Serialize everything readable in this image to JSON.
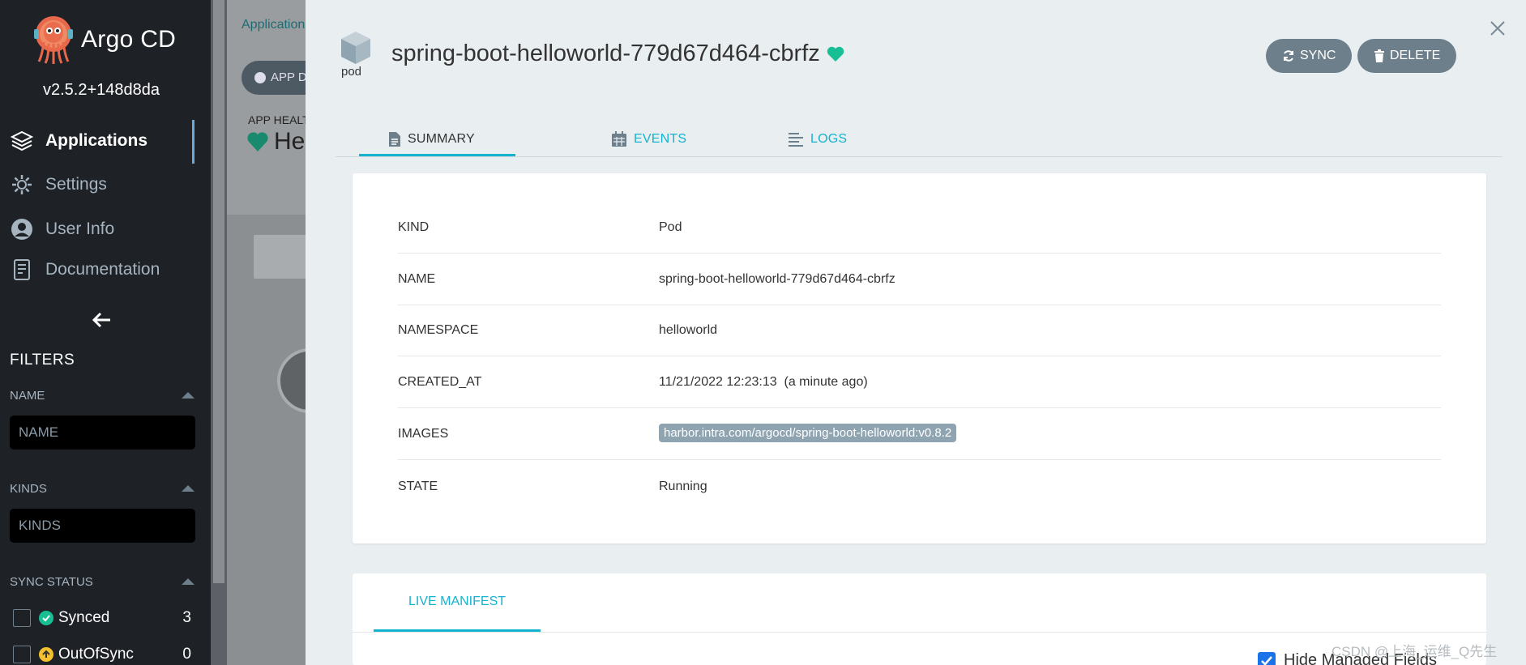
{
  "sidebar": {
    "brand": "Argo CD",
    "version": "v2.5.2+148d8da",
    "nav": [
      {
        "label": "Applications",
        "icon": "layers-icon",
        "active": true
      },
      {
        "label": "Settings",
        "icon": "gear-icon"
      },
      {
        "label": "User Info",
        "icon": "user-icon"
      },
      {
        "label": "Documentation",
        "icon": "book-icon"
      }
    ],
    "filters_title": "FILTERS",
    "name_label": "NAME",
    "name_placeholder": "NAME",
    "kinds_label": "KINDS",
    "kinds_placeholder": "KINDS",
    "sync_status_label": "SYNC STATUS",
    "sync_status": [
      {
        "label": "Synced",
        "count": "3",
        "color": "#18be94"
      },
      {
        "label": "OutOfSync",
        "count": "0",
        "color": "#f4c030"
      }
    ]
  },
  "background": {
    "breadcrumb": "Applications",
    "app_details_button": "APP DETAILS",
    "app_health_label": "APP HEALTH",
    "app_health_value": "Healthy"
  },
  "panel": {
    "kind_icon_label": "pod",
    "title": "spring-boot-helloworld-779d67d464-cbrfz",
    "sync_button": "SYNC",
    "delete_button": "DELETE",
    "tabs": [
      {
        "label": "SUMMARY",
        "icon": "document-icon",
        "active": true
      },
      {
        "label": "EVENTS",
        "icon": "calendar-icon"
      },
      {
        "label": "LOGS",
        "icon": "lines-icon"
      }
    ],
    "summary": {
      "kind_key": "KIND",
      "kind": "Pod",
      "name_key": "NAME",
      "name": "spring-boot-helloworld-779d67d464-cbrfz",
      "namespace_key": "NAMESPACE",
      "namespace": "helloworld",
      "created_key": "CREATED_AT",
      "created": "11/21/2022 12:23:13  (a minute ago)",
      "images_key": "IMAGES",
      "image": "harbor.intra.com/argocd/spring-boot-helloworld:v0.8.2",
      "state_key": "STATE",
      "state": "Running"
    },
    "manifest_tab": "LIVE MANIFEST",
    "hide_managed_fields": "Hide Managed Fields"
  },
  "watermark": "CSDN @上海_运维_Q先生",
  "colors": {
    "accent": "#15b3d0",
    "healthy": "#18be94",
    "sidebar_bg": "#1e2126",
    "button_bg": "#6d7f8b"
  }
}
